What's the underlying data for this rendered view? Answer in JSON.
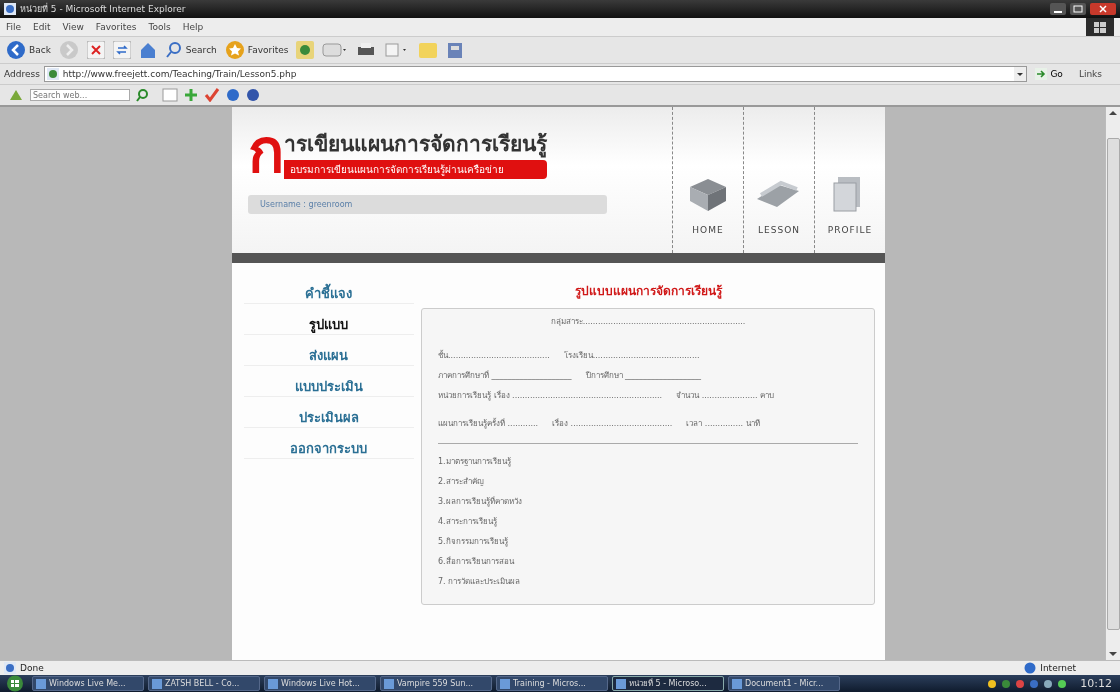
{
  "window": {
    "title": "หน่วยที่ 5 - Microsoft Internet Explorer"
  },
  "menu": [
    "File",
    "Edit",
    "View",
    "Favorites",
    "Tools",
    "Help"
  ],
  "toolbar": {
    "back": "Back",
    "search": "Search",
    "favorites": "Favorites"
  },
  "address_bar": {
    "label": "Address",
    "value": "http://www.freejett.com/Teaching/Train/Lesson5.php",
    "go": "Go",
    "links": "Links"
  },
  "search_toolbar": {
    "placeholder": "Search web..."
  },
  "page": {
    "logo": {
      "initial": "ก",
      "title": "ารเขียนแผนการจัดการเรียนรู้",
      "subtitle": "อบรมการเขียนแผนการจัดการเรียนรู้ผ่านเครือข่าย"
    },
    "user": "Username : greenroom",
    "nav": [
      {
        "label": "HOME",
        "kind": "home"
      },
      {
        "label": "LESSON",
        "kind": "lesson"
      },
      {
        "label": "PROFILE",
        "kind": "profile"
      }
    ],
    "sidebar": {
      "items": [
        {
          "label": "คำชี้แจง",
          "selected": false
        },
        {
          "label": "รูปแบบ",
          "selected": true
        },
        {
          "label": "ส่งแผน",
          "selected": false
        },
        {
          "label": "แบบประเมิน",
          "selected": false
        },
        {
          "label": "ประเมินผล",
          "selected": false
        },
        {
          "label": "ออกจากระบบ",
          "selected": false
        }
      ]
    },
    "form": {
      "title": "รูปแบบแผนการจัดการเรียนรู้",
      "header_lines": [
        [
          "กลุ่มสาระ................................................................"
        ],
        [
          "ชั้น........................................",
          "โรงเรียน.........................................."
        ],
        [
          "ภาคการศึกษาที่ ____________________",
          "ปีการศึกษา ___________________"
        ],
        [
          "หน่วยการเรียนรู้ เรื่อง ...........................................................",
          "จำนวน ...................... คาบ"
        ],
        [
          "แผนการเรียนรู้ครั้งที่ ............",
          "เรื่อง ........................................",
          "เวลา ............... นาที"
        ]
      ],
      "sections": [
        "1.มาตรฐานการเรียนรู้",
        "2.สาระสำคัญ",
        "3.ผลการเรียนรู้ที่คาดหวัง",
        "4.สาระการเรียนรู้",
        "5.กิจกรรมการเรียนรู้",
        "6.สื่อการเรียนการสอน",
        "7. การวัดและประเมินผล"
      ]
    }
  },
  "status_bar": {
    "status": "Done",
    "zone": "Internet"
  },
  "taskbar": {
    "items": [
      {
        "label": "Windows Live Me...",
        "selected": false
      },
      {
        "label": "ZATSH BELL - Co...",
        "selected": false
      },
      {
        "label": "Windows Live Hot...",
        "selected": false
      },
      {
        "label": "Vampire 559 Sun...",
        "selected": false
      },
      {
        "label": "Training - Micros...",
        "selected": false
      },
      {
        "label": "หน่วยที่ 5 - Microso...",
        "selected": true
      },
      {
        "label": "Document1 - Micr...",
        "selected": false
      }
    ],
    "clock": "10:12"
  }
}
